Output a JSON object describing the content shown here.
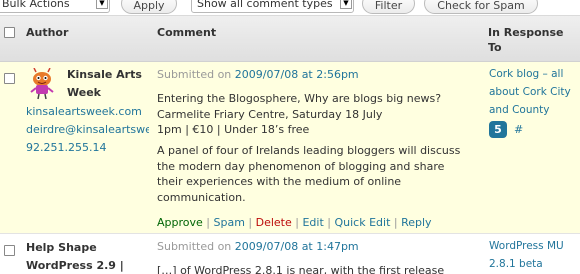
{
  "toolbar": {
    "bulk_actions": "Bulk Actions",
    "apply": "Apply",
    "comment_type": "Show all comment types",
    "filter": "Filter",
    "check_spam": "Check for Spam"
  },
  "table": {
    "headers": {
      "author": "Author",
      "comment": "Comment",
      "response_line1": "In Response",
      "response_line2": "To"
    },
    "rows": [
      {
        "author_name_line1": "Kinsale Arts",
        "author_name_line2": "Week",
        "author_url": "kinsaleartsweek.com",
        "author_email": "deirdre@kinsaleartswe",
        "author_ip": "92.251.255.14",
        "submitted_label": "Submitted on",
        "submitted_date": "2009/07/08 at 2:56pm",
        "body_lines": [
          "Entering the Blogosphere, Why are blogs big news?",
          "Carmelite Friary Centre, Saturday 18 July",
          "1pm | €10 | Under 18’s free"
        ],
        "body2_lines": [
          "A panel of four of Irelands leading bloggers will discuss",
          "the modern day phenomenon of blogging and share",
          "their experiences with the medium of online",
          "communication."
        ],
        "actions": {
          "approve": "Approve",
          "spam": "Spam",
          "delete": "Delete",
          "edit": "Edit",
          "quick_edit": "Quick Edit",
          "reply": "Reply",
          "sep": " | "
        },
        "response_lines": [
          "Cork blog – all",
          "about Cork City",
          "and County"
        ],
        "comment_count": "5",
        "permalink": "#"
      },
      {
        "author_name_line1": "Help Shape",
        "author_name_line2": "WordPress 2.9 |",
        "submitted_label": "Submitted on",
        "submitted_date": "2009/07/08 at 1:47pm",
        "body_line": "[…] of WordPress 2.8.1 is near, with the first release",
        "response_lines": [
          "WordPress MU",
          "2.8.1 beta"
        ]
      }
    ]
  },
  "colors": {
    "link": "#21759b",
    "approve": "#006505",
    "delete": "#bc0b0b",
    "highlight_row": "#ffffe0"
  }
}
